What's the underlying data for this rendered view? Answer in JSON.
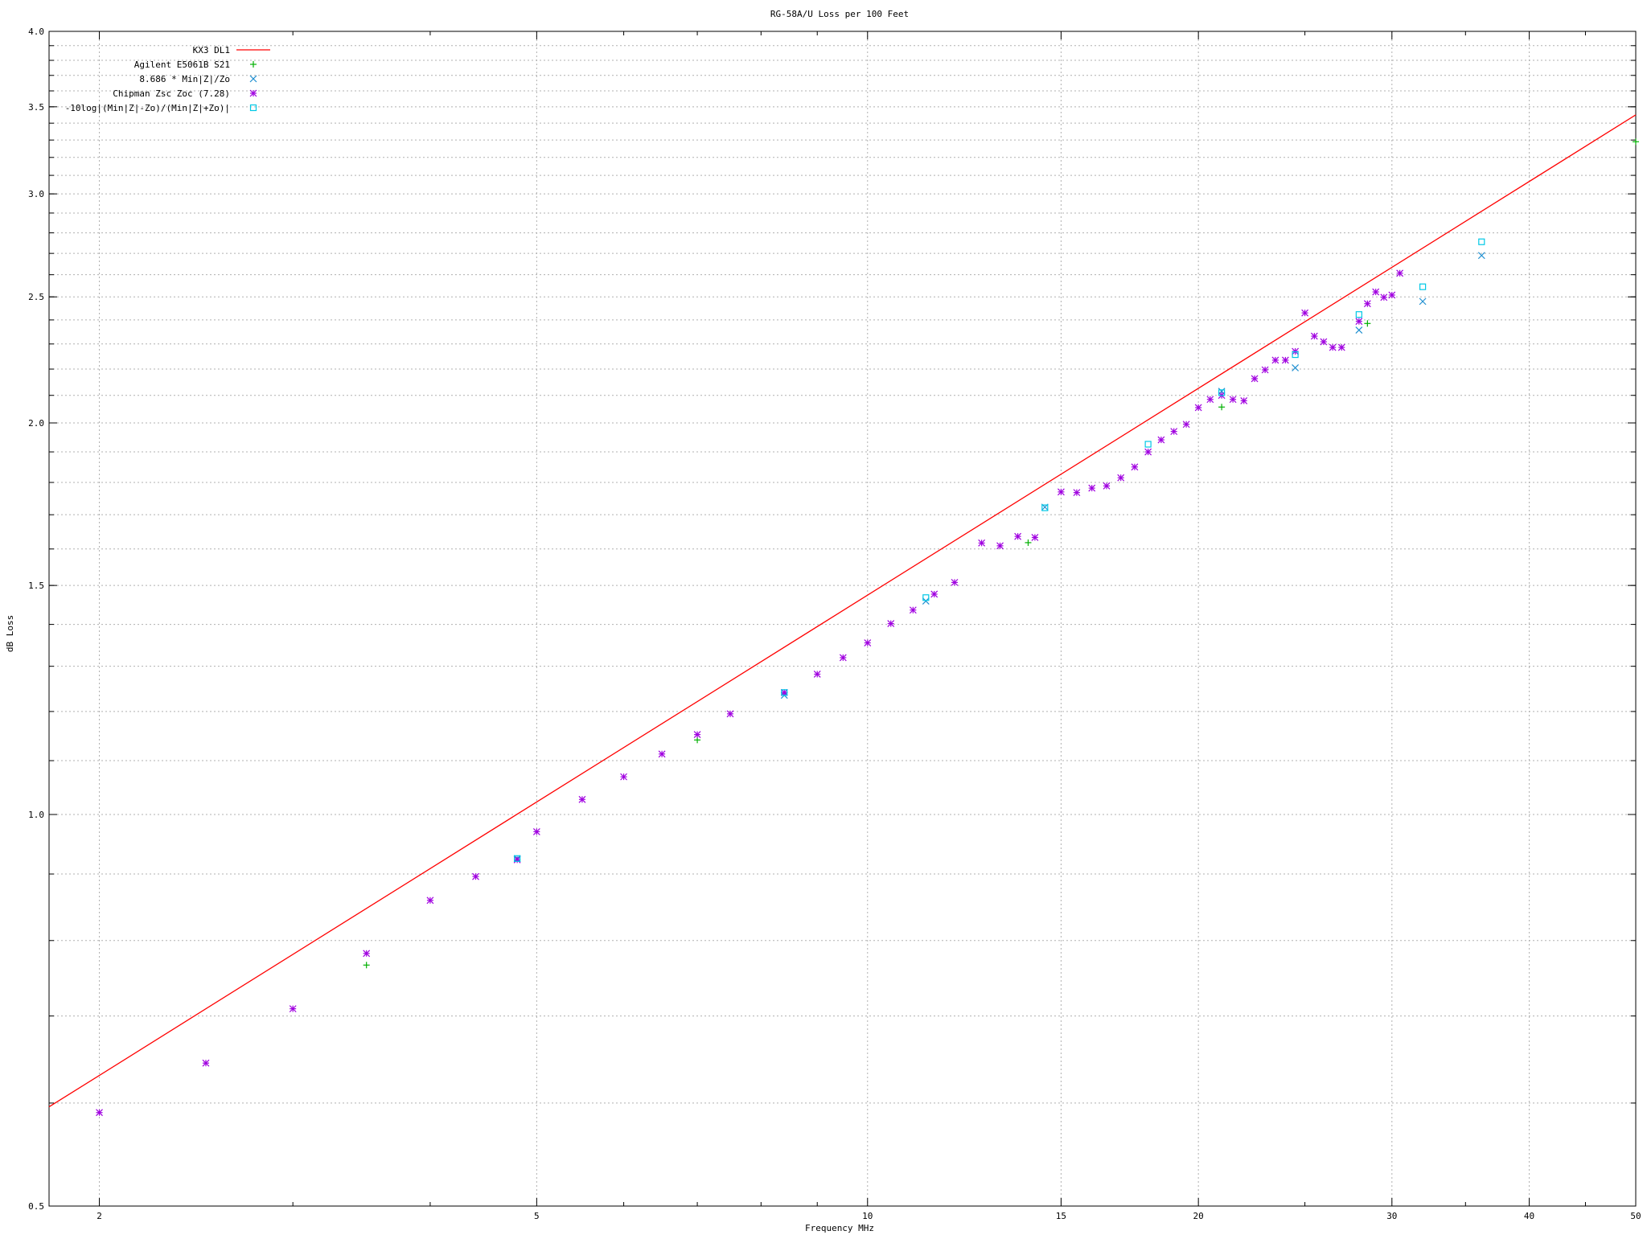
{
  "chart_data": {
    "type": "scatter",
    "title": "RG-58A/U Loss per 100 Feet",
    "xlabel": "Frequency MHz",
    "ylabel": "dB Loss",
    "x_scale": "log",
    "y_scale": "log",
    "xlim": [
      1.8,
      50
    ],
    "ylim": [
      0.5,
      4.0
    ],
    "x_ticks": [
      2,
      5,
      10,
      15,
      20,
      30,
      40,
      50
    ],
    "y_ticks": [
      0.5,
      1.0,
      1.5,
      2.0,
      2.5,
      3.0,
      3.5,
      4.0
    ],
    "grid": true,
    "legend_position": "top-left",
    "series": [
      {
        "name": "KX3 DL1",
        "style": "line",
        "color": "#ff0000",
        "points": [
          [
            1.8,
            0.596
          ],
          [
            50,
            3.45
          ]
        ]
      },
      {
        "name": "Agilent E5061B S21",
        "style": "plus",
        "color": "#00b000",
        "points": [
          [
            3.5,
            0.766
          ],
          [
            7.0,
            1.141
          ],
          [
            14.0,
            1.618
          ],
          [
            21.0,
            2.057
          ],
          [
            28.5,
            2.385
          ],
          [
            50.0,
            3.29
          ]
        ]
      },
      {
        "name": "8.686 * Min|Z|/Zo",
        "style": "cross",
        "color": "#1f8fd0",
        "points": [
          [
            4.8,
            0.925
          ],
          [
            8.4,
            1.235
          ],
          [
            11.3,
            1.459
          ],
          [
            14.5,
            1.723
          ],
          [
            21.0,
            2.115
          ],
          [
            24.5,
            2.205
          ],
          [
            28.0,
            2.357
          ],
          [
            32.0,
            2.48
          ],
          [
            36.2,
            2.69
          ]
        ]
      },
      {
        "name": "Chipman Zsc Zoc (7.28)",
        "style": "star",
        "color": "#a000e0",
        "points": [
          [
            2.0,
            0.59
          ],
          [
            2.5,
            0.644
          ],
          [
            3.0,
            0.709
          ],
          [
            3.5,
            0.782
          ],
          [
            4.0,
            0.859
          ],
          [
            4.4,
            0.896
          ],
          [
            4.8,
            0.923
          ],
          [
            5.0,
            0.97
          ],
          [
            5.5,
            1.027
          ],
          [
            6.0,
            1.069
          ],
          [
            6.5,
            1.113
          ],
          [
            7.0,
            1.152
          ],
          [
            7.5,
            1.195
          ],
          [
            8.4,
            1.241
          ],
          [
            9.0,
            1.282
          ],
          [
            9.5,
            1.32
          ],
          [
            10.0,
            1.355
          ],
          [
            10.5,
            1.402
          ],
          [
            11.0,
            1.436
          ],
          [
            11.5,
            1.477
          ],
          [
            12.0,
            1.508
          ],
          [
            12.7,
            1.617
          ],
          [
            13.2,
            1.609
          ],
          [
            13.7,
            1.636
          ],
          [
            14.2,
            1.633
          ],
          [
            15.0,
            1.77
          ],
          [
            15.5,
            1.768
          ],
          [
            16.0,
            1.782
          ],
          [
            16.5,
            1.789
          ],
          [
            17.0,
            1.815
          ],
          [
            17.5,
            1.85
          ],
          [
            18.0,
            1.9
          ],
          [
            18.5,
            1.941
          ],
          [
            19.0,
            1.97
          ],
          [
            19.5,
            1.995
          ],
          [
            20.0,
            2.055
          ],
          [
            20.5,
            2.085
          ],
          [
            21.0,
            2.1
          ],
          [
            21.5,
            2.085
          ],
          [
            22.0,
            2.08
          ],
          [
            22.5,
            2.163
          ],
          [
            23.0,
            2.197
          ],
          [
            23.5,
            2.235
          ],
          [
            24.0,
            2.235
          ],
          [
            24.5,
            2.27
          ],
          [
            25.0,
            2.43
          ],
          [
            25.5,
            2.332
          ],
          [
            26.0,
            2.309
          ],
          [
            26.5,
            2.286
          ],
          [
            27.0,
            2.286
          ],
          [
            28.0,
            2.394
          ],
          [
            28.5,
            2.47
          ],
          [
            29.0,
            2.522
          ],
          [
            29.5,
            2.498
          ],
          [
            30.0,
            2.508
          ],
          [
            30.5,
            2.607
          ]
        ]
      },
      {
        "name": "-10log|(Min|Z|-Zo)/(Min|Z|+Zo)|",
        "style": "square",
        "color": "#00c8e6",
        "points": [
          [
            4.8,
            0.925
          ],
          [
            8.4,
            1.241
          ],
          [
            11.3,
            1.468
          ],
          [
            14.5,
            1.721
          ],
          [
            18.0,
            1.926
          ],
          [
            21.0,
            2.11
          ],
          [
            24.5,
            2.257
          ],
          [
            28.0,
            2.423
          ],
          [
            32.0,
            2.545
          ],
          [
            36.2,
            2.756
          ]
        ]
      }
    ]
  }
}
